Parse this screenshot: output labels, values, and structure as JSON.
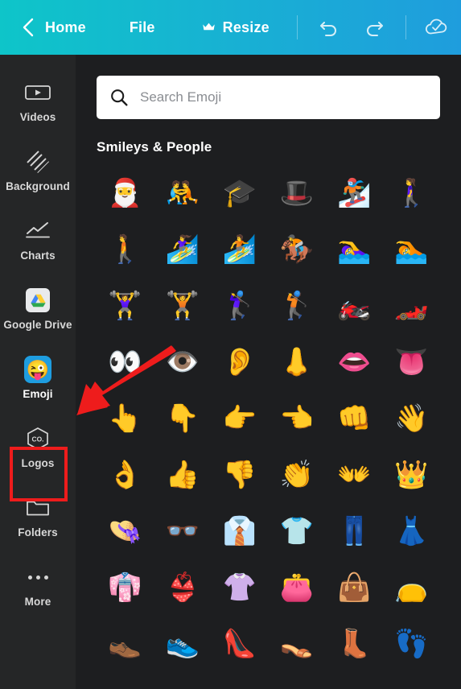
{
  "topbar": {
    "back_icon": "chevron-left-icon",
    "home_label": "Home",
    "file_label": "File",
    "resize_label": "Resize",
    "resize_crown_icon": "crown-icon",
    "undo_icon": "undo-icon",
    "redo_icon": "redo-icon",
    "cloud_saved_icon": "cloud-check-icon",
    "gradient_left": "#0ec5c9",
    "gradient_right": "#1f9ddd"
  },
  "sidebar": {
    "items": [
      {
        "label": "Videos",
        "icon": "video-icon",
        "selected": false
      },
      {
        "label": "Background",
        "icon": "background-hatch-icon",
        "selected": false
      },
      {
        "label": "Charts",
        "icon": "line-chart-icon",
        "selected": false
      },
      {
        "label": "Google Drive",
        "icon": "google-drive-icon",
        "selected": false
      },
      {
        "label": "Emoji",
        "icon": "emoji-icon",
        "selected": true
      },
      {
        "label": "Logos",
        "icon": "logos-hexagon-icon",
        "selected": false
      },
      {
        "label": "Folders",
        "icon": "folder-icon",
        "selected": false
      },
      {
        "label": "More",
        "icon": "more-dots-icon",
        "selected": false
      }
    ]
  },
  "search": {
    "placeholder": "Search Emoji",
    "value": "",
    "icon": "search-icon"
  },
  "panel": {
    "section_title": "Smileys & People",
    "emoji_rows": [
      [
        {
          "glyph": "🎅",
          "name": "santa-claus"
        },
        {
          "glyph": "🤼",
          "name": "mrs-claus-red"
        },
        {
          "glyph": "🎓",
          "name": "graduation-cap"
        },
        {
          "glyph": "🎩",
          "name": "top-hat"
        },
        {
          "glyph": "🏂",
          "name": "snowboarder"
        },
        {
          "glyph": "🚶‍♀️",
          "name": "woman-walking"
        }
      ],
      [
        {
          "glyph": "🚶",
          "name": "person-walking"
        },
        {
          "glyph": "🏄‍♀️",
          "name": "woman-surfing"
        },
        {
          "glyph": "🏄",
          "name": "man-surfing"
        },
        {
          "glyph": "🏇",
          "name": "horse-racing"
        },
        {
          "glyph": "🏊‍♀️",
          "name": "woman-swimming"
        },
        {
          "glyph": "🏊",
          "name": "man-swimming"
        }
      ],
      [
        {
          "glyph": "🏋️‍♀️",
          "name": "woman-lifting-weights"
        },
        {
          "glyph": "🏋️",
          "name": "man-lifting-weights"
        },
        {
          "glyph": "🏌️‍♀️",
          "name": "woman-golfing"
        },
        {
          "glyph": "🏌️",
          "name": "man-golfing"
        },
        {
          "glyph": "🏍️",
          "name": "motorcycle"
        },
        {
          "glyph": "🏎️",
          "name": "racing-car"
        }
      ],
      [
        {
          "glyph": "👀",
          "name": "eyes"
        },
        {
          "glyph": "👁️",
          "name": "eye"
        },
        {
          "glyph": "👂",
          "name": "ear"
        },
        {
          "glyph": "👃",
          "name": "nose"
        },
        {
          "glyph": "👄",
          "name": "mouth"
        },
        {
          "glyph": "👅",
          "name": "tongue"
        }
      ],
      [
        {
          "glyph": "👆",
          "name": "backhand-index-pointing-up"
        },
        {
          "glyph": "👇",
          "name": "backhand-index-pointing-down"
        },
        {
          "glyph": "👉",
          "name": "backhand-index-pointing-right"
        },
        {
          "glyph": "👈",
          "name": "backhand-index-pointing-left"
        },
        {
          "glyph": "👊",
          "name": "oncoming-fist"
        },
        {
          "glyph": "👋",
          "name": "waving-hand"
        }
      ],
      [
        {
          "glyph": "👌",
          "name": "ok-hand"
        },
        {
          "glyph": "👍",
          "name": "thumbs-up"
        },
        {
          "glyph": "👎",
          "name": "thumbs-down"
        },
        {
          "glyph": "👏",
          "name": "clapping-hands"
        },
        {
          "glyph": "👐",
          "name": "open-hands"
        },
        {
          "glyph": "👑",
          "name": "crown"
        }
      ],
      [
        {
          "glyph": "👒",
          "name": "womans-hat"
        },
        {
          "glyph": "👓",
          "name": "glasses"
        },
        {
          "glyph": "👔",
          "name": "necktie"
        },
        {
          "glyph": "👕",
          "name": "t-shirt"
        },
        {
          "glyph": "👖",
          "name": "jeans"
        },
        {
          "glyph": "👗",
          "name": "dress"
        }
      ],
      [
        {
          "glyph": "👘",
          "name": "kimono"
        },
        {
          "glyph": "👙",
          "name": "bikini"
        },
        {
          "glyph": "👚",
          "name": "womans-clothes"
        },
        {
          "glyph": "👛",
          "name": "purse"
        },
        {
          "glyph": "👜",
          "name": "handbag"
        },
        {
          "glyph": "👝",
          "name": "clutch-bag"
        }
      ],
      [
        {
          "glyph": "👞",
          "name": "mans-shoe"
        },
        {
          "glyph": "👟",
          "name": "running-shoe"
        },
        {
          "glyph": "👠",
          "name": "high-heeled-shoe"
        },
        {
          "glyph": "👡",
          "name": "womans-sandal"
        },
        {
          "glyph": "👢",
          "name": "womans-boot"
        },
        {
          "glyph": "👣",
          "name": "footprints"
        }
      ]
    ]
  },
  "annotation": {
    "highlight_color": "#ee1c1c",
    "arrow_color": "#ee1c1c",
    "highlight_target": "Emoji",
    "arrow_points_to": "Emoji"
  }
}
